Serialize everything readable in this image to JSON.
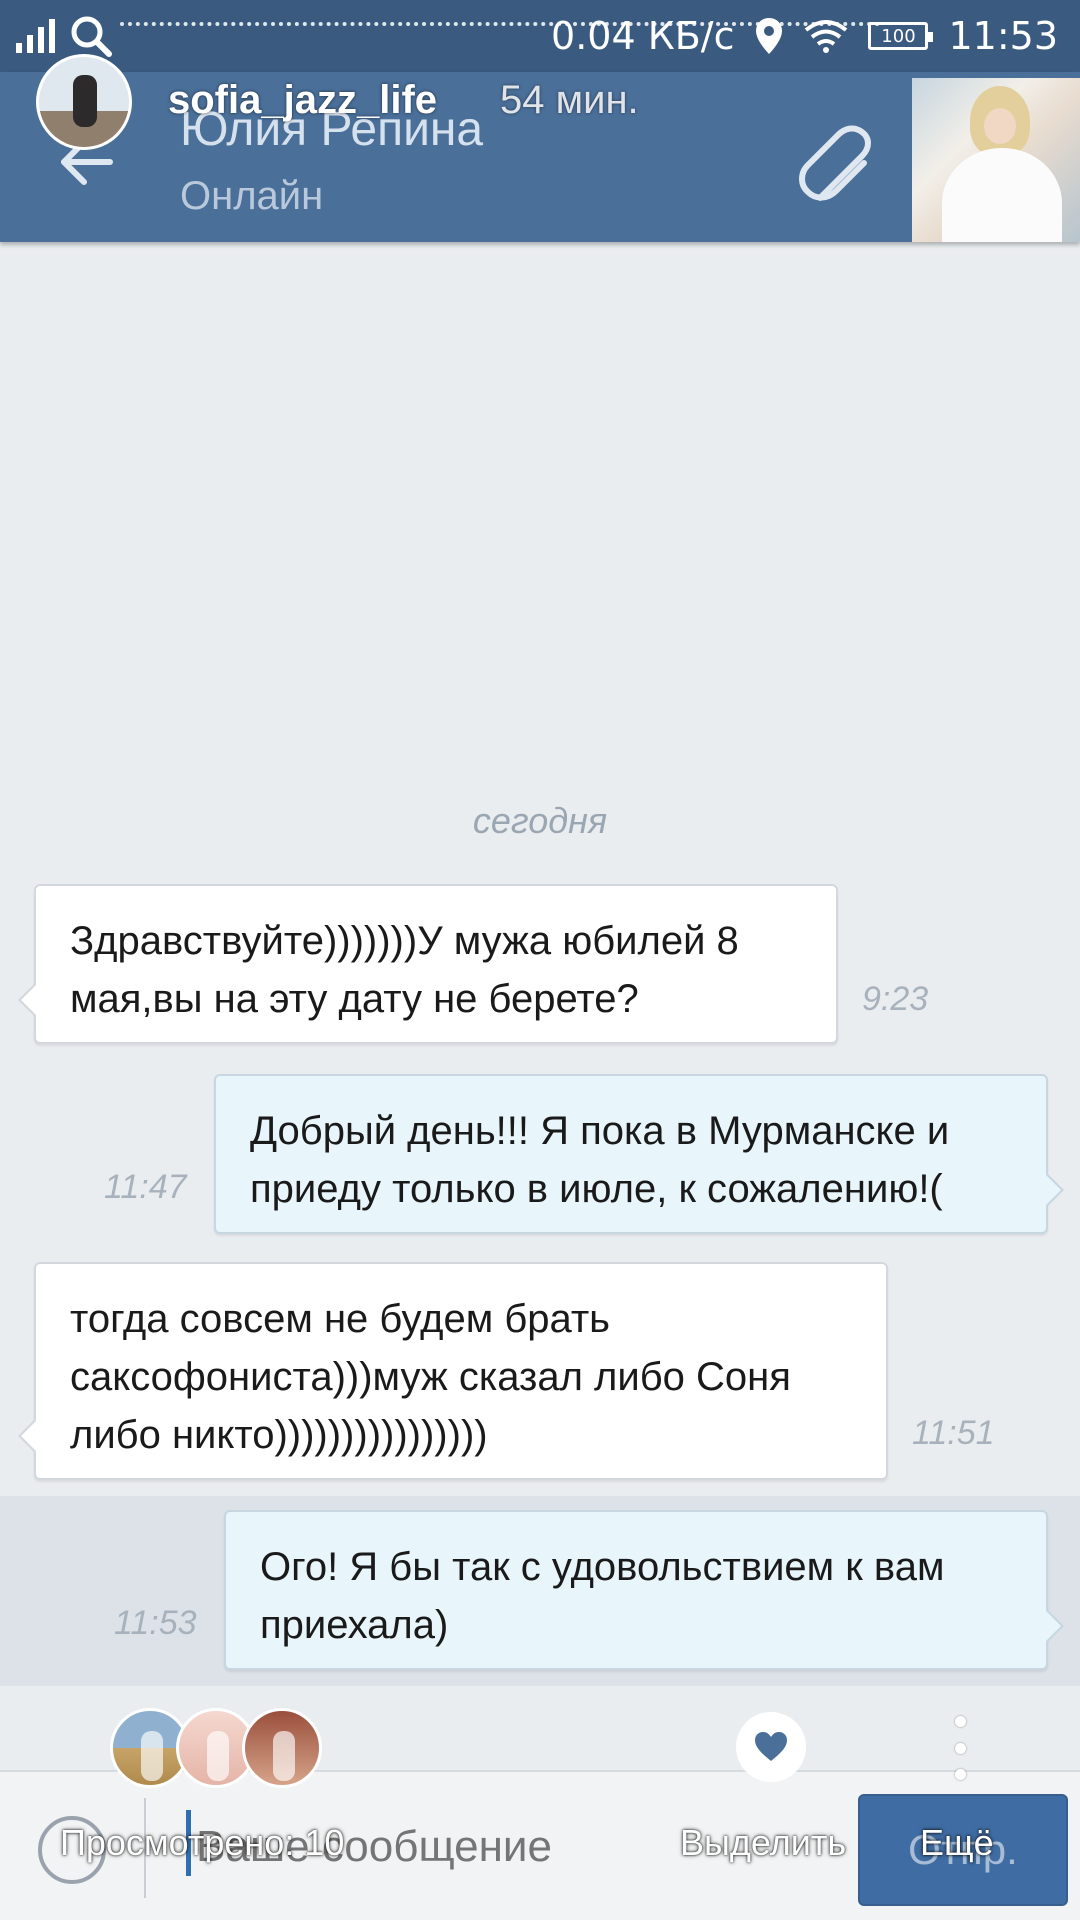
{
  "status_bar": {
    "speed": "0.04 КБ/с",
    "battery": "100",
    "time": "11:53"
  },
  "header": {
    "chat_name": "Юлия Репина",
    "chat_status": "Онлайн"
  },
  "story": {
    "username": "sofia_jazz_life",
    "posted_ago": "54 мин.",
    "seen_label": "Просмотрено: 10",
    "highlight_label": "Выделить",
    "more_label": "Ещё"
  },
  "chat": {
    "date_separator": "сегодня",
    "messages": [
      {
        "direction": "in",
        "text": "Здравствуйте)))))))У мужа юбилей 8 мая,вы на эту дату не берете?",
        "time": "9:23"
      },
      {
        "direction": "out",
        "text": "Добрый день!!! Я пока в Мурманске и приеду только в июле, к сожалению!(",
        "time": "11:47"
      },
      {
        "direction": "in",
        "text": "тогда совсем не будем брать саксофониста)))муж сказал либо Соня либо никто))))))))))))))))",
        "time": "11:51"
      },
      {
        "direction": "out",
        "text": "Ого! Я бы так с удовольствием к вам приехала)",
        "time": "11:53"
      }
    ]
  },
  "composer": {
    "placeholder": "Ваше сообщение",
    "send_label": "Отпр."
  },
  "colors": {
    "header_bg": "#4a6f99",
    "statusbar_bg": "#3a5a80",
    "incoming_bubble": "#ffffff",
    "outgoing_bubble": "#e8f5fb",
    "send_button": "#3f6da3"
  }
}
